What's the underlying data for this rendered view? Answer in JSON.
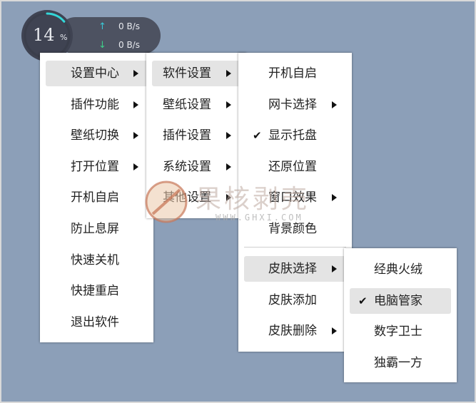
{
  "widget": {
    "cpu_value": "14",
    "cpu_unit": "%",
    "cpu_percent": 14,
    "upload_icon": "arrow-up-icon",
    "download_icon": "arrow-down-icon",
    "upload_speed": "0 B/s",
    "download_speed": "0 B/s",
    "ring_color": "#33d6d8"
  },
  "menu_main": {
    "items": [
      {
        "label": "设置中心",
        "submenu": true,
        "highlighted": true
      },
      {
        "label": "插件功能",
        "submenu": true
      },
      {
        "label": "壁纸切换",
        "submenu": true
      },
      {
        "label": "打开位置",
        "submenu": true
      },
      {
        "label": "开机自启"
      },
      {
        "label": "防止息屏"
      },
      {
        "label": "快速关机"
      },
      {
        "label": "快捷重启"
      },
      {
        "label": "退出软件"
      }
    ]
  },
  "menu_settings": {
    "items": [
      {
        "label": "软件设置",
        "submenu": true,
        "highlighted": true
      },
      {
        "label": "壁纸设置",
        "submenu": true
      },
      {
        "label": "插件设置",
        "submenu": true
      },
      {
        "label": "系统设置",
        "submenu": true
      },
      {
        "label": "其他设置",
        "submenu": true
      }
    ]
  },
  "menu_software": {
    "items": [
      {
        "label": "开机自启"
      },
      {
        "label": "网卡选择",
        "submenu": true
      },
      {
        "label": "显示托盘",
        "checked": true
      },
      {
        "label": "还原位置"
      },
      {
        "label": "窗口效果",
        "submenu": true
      },
      {
        "label": "背景颜色"
      }
    ],
    "items_after_separator": [
      {
        "label": "皮肤选择",
        "submenu": true,
        "highlighted": true
      },
      {
        "label": "皮肤添加"
      },
      {
        "label": "皮肤删除",
        "submenu": true
      }
    ]
  },
  "menu_skin": {
    "items": [
      {
        "label": "经典火绒"
      },
      {
        "label": "电脑管家",
        "checked": true,
        "highlighted": true
      },
      {
        "label": "数字卫士"
      },
      {
        "label": "独霸一方"
      }
    ]
  },
  "watermark": {
    "text": "果核剥壳",
    "url": "WWW.GHXI.COM"
  },
  "colors": {
    "background": "#8c9fb8",
    "menu_bg": "#ffffff",
    "highlight": "#e4e4e4"
  }
}
